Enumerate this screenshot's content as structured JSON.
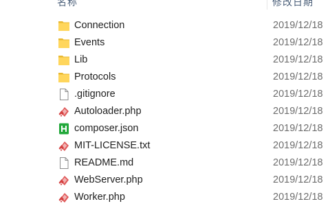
{
  "header": {
    "name_label": "名称",
    "date_label": "修改日期"
  },
  "files": [
    {
      "name": "Connection",
      "date": "2019/12/18",
      "icon": "folder-icon"
    },
    {
      "name": "Events",
      "date": "2019/12/18",
      "icon": "folder-icon"
    },
    {
      "name": "Lib",
      "date": "2019/12/18",
      "icon": "folder-icon"
    },
    {
      "name": "Protocols",
      "date": "2019/12/18",
      "icon": "folder-icon"
    },
    {
      "name": ".gitignore",
      "date": "2019/12/18",
      "icon": "blank-file-icon"
    },
    {
      "name": "Autoloader.php",
      "date": "2019/12/18",
      "icon": "php-file-icon"
    },
    {
      "name": "composer.json",
      "date": "2019/12/18",
      "icon": "json-file-icon"
    },
    {
      "name": "MIT-LICENSE.txt",
      "date": "2019/12/18",
      "icon": "php-file-icon"
    },
    {
      "name": "README.md",
      "date": "2019/12/18",
      "icon": "blank-file-icon"
    },
    {
      "name": "WebServer.php",
      "date": "2019/12/18",
      "icon": "php-file-icon"
    },
    {
      "name": "Worker.php",
      "date": "2019/12/18",
      "icon": "php-file-icon"
    }
  ],
  "colors": {
    "folder": "#ffd65c",
    "json_icon": "#22a83a",
    "date_text": "#6d6d6d",
    "header_text": "#4c607a"
  }
}
